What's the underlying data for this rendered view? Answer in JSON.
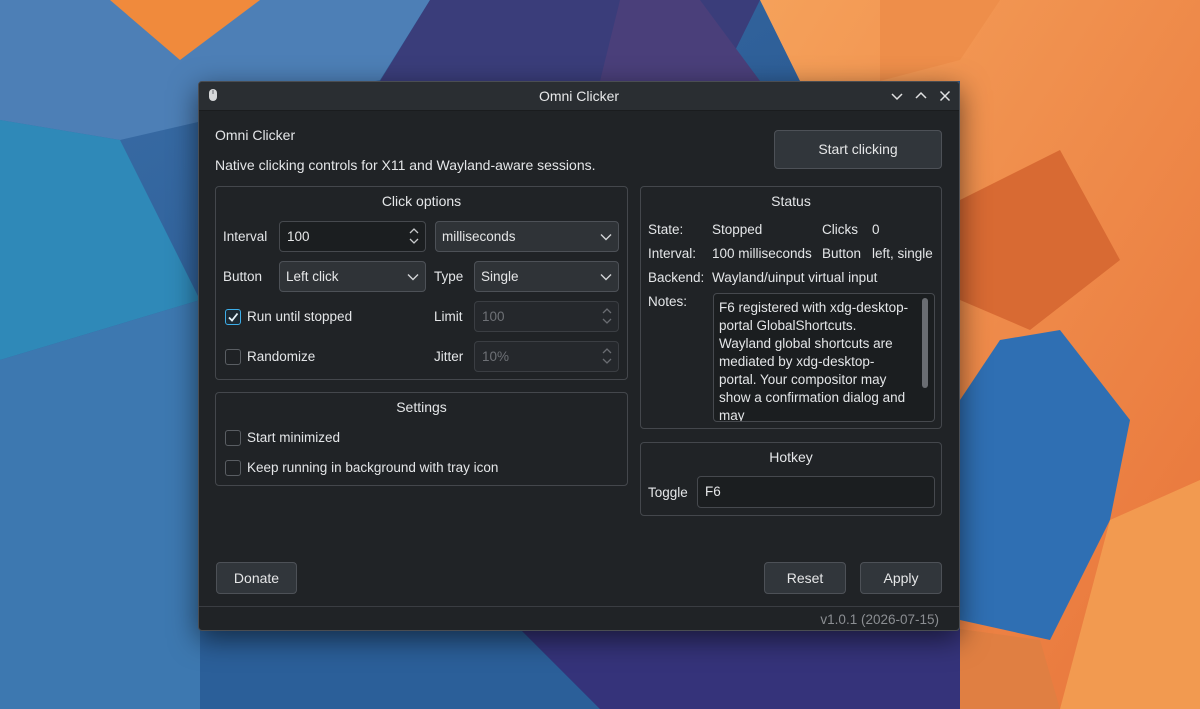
{
  "window": {
    "title": "Omni Clicker",
    "controls": [
      "chevron-down-icon",
      "chevron-up-icon",
      "close-icon"
    ]
  },
  "header": {
    "app_name": "Omni Clicker",
    "tagline": "Native clicking controls for X11 and Wayland-aware sessions.",
    "start_label": "Start clicking"
  },
  "click_options": {
    "title": "Click options",
    "interval_label": "Interval",
    "interval_value": "100",
    "interval_unit": "milliseconds",
    "button_label": "Button",
    "button_value": "Left click",
    "type_label": "Type",
    "type_value": "Single",
    "run_until_stopped_label": "Run until stopped",
    "run_until_stopped_checked": true,
    "limit_label": "Limit",
    "limit_value": "100",
    "randomize_label": "Randomize",
    "randomize_checked": false,
    "jitter_label": "Jitter",
    "jitter_value": "10%"
  },
  "settings": {
    "title": "Settings",
    "start_minimized_label": "Start minimized",
    "start_minimized_checked": false,
    "background_label": "Keep running in background with tray icon",
    "background_checked": false
  },
  "status": {
    "title": "Status",
    "state_label": "State:",
    "state_value": "Stopped",
    "clicks_label": "Clicks",
    "clicks_value": "0",
    "interval_label": "Interval:",
    "interval_value": "100 milliseconds",
    "button_label": "Button",
    "button_value": "left, single",
    "backend_label": "Backend:",
    "backend_value": "Wayland/uinput virtual input",
    "notes_label": "Notes:",
    "notes_text": "F6 registered with xdg-desktop-portal GlobalShortcuts. Wayland global shortcuts are mediated by xdg-desktop-portal. Your compositor may show a confirmation dialog and may"
  },
  "hotkey": {
    "title": "Hotkey",
    "toggle_label": "Toggle",
    "toggle_value": "F6"
  },
  "footer": {
    "donate_label": "Donate",
    "reset_label": "Reset",
    "apply_label": "Apply",
    "version": "v1.0.1 (2026-07-15)"
  },
  "colors": {
    "accent": "#3daee9",
    "window_bg": "#202326",
    "wallpaper_orange": "#f08a3c",
    "wallpaper_blue": "#2a78b8"
  }
}
